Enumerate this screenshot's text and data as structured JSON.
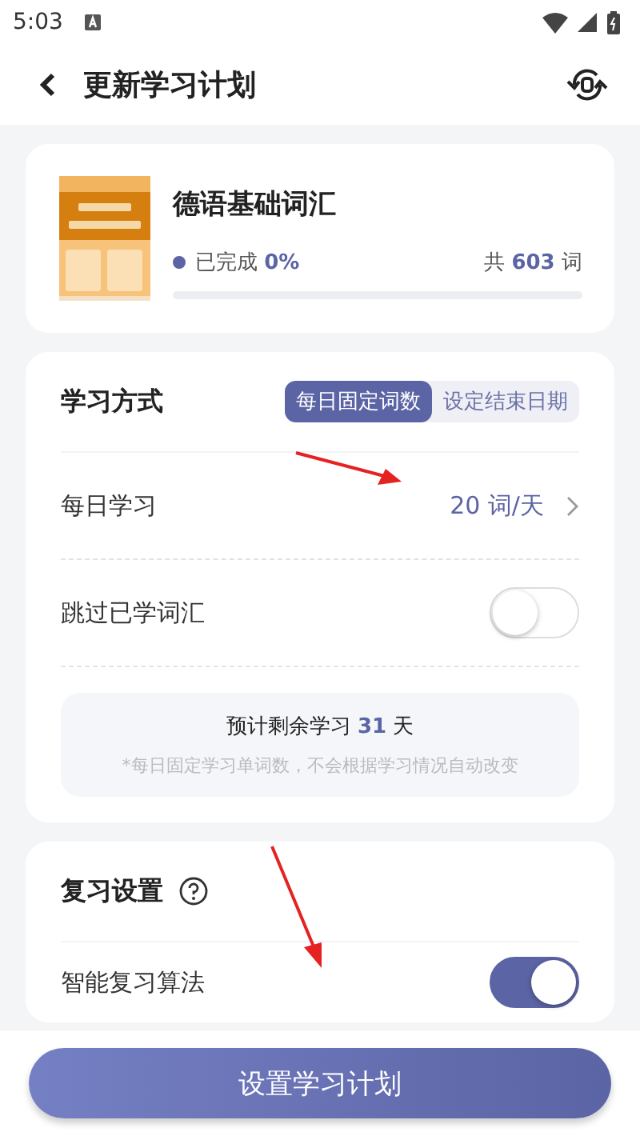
{
  "status_bar": {
    "time": "5:03"
  },
  "header": {
    "title": "更新学习计划"
  },
  "book": {
    "kind": "picture",
    "title": "德语基础词汇",
    "completed": "已完成 **0%**",
    "total": "共 **603** 词",
    "level": 0
  },
  "study_mode": {
    "title": "学习方式",
    "options": [
      {
        "label": "每日固定词数",
        "selected": true
      },
      {
        "label": "设定结束日期",
        "selected": false
      }
    ],
    "rows": [
      {
        "kind": "value",
        "label": "每日学习",
        "value": "20 词/天"
      },
      {
        "kind": "toggle",
        "label": "跳过已学词汇",
        "on": false
      }
    ],
    "estimate": {
      "text": "预计剩余学习 **31** 天",
      "note": "*每日固定学习单词数，不会根据学习情况自动改变"
    }
  },
  "review": {
    "title": "复习设置",
    "rows": [
      {
        "kind": "toggle",
        "label": "智能复习算法",
        "on": true
      }
    ]
  },
  "primary_button": "设置学习计划"
}
